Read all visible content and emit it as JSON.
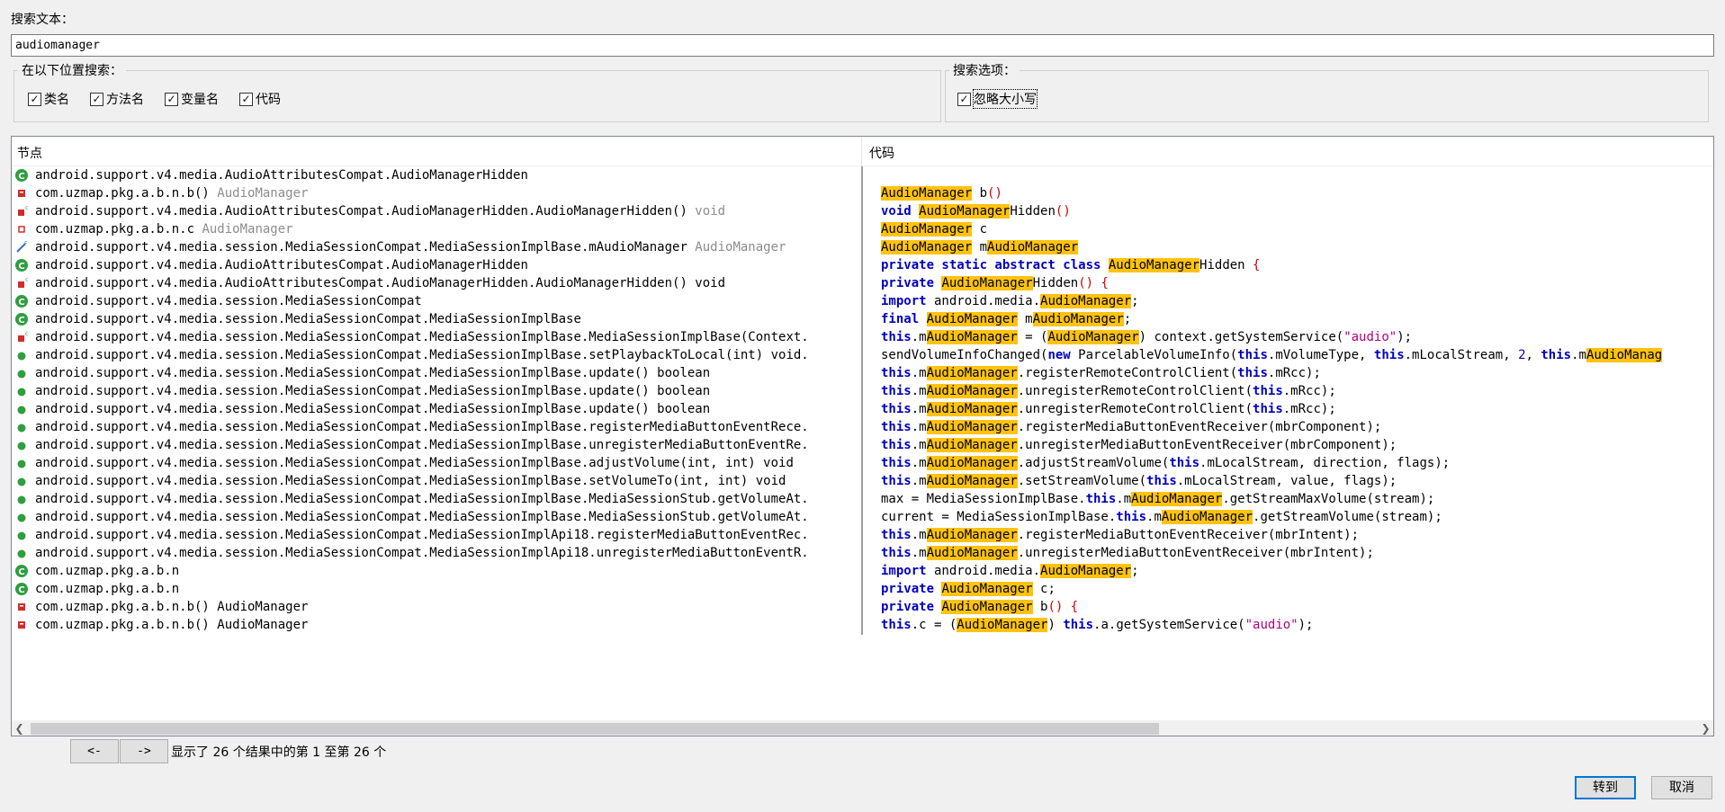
{
  "search": {
    "label": "搜索文本：",
    "value": "audiomanager"
  },
  "location_group": {
    "title": "在以下位置搜索：",
    "options": [
      {
        "label": "类名",
        "checked": true
      },
      {
        "label": "方法名",
        "checked": true
      },
      {
        "label": "变量名",
        "checked": true
      },
      {
        "label": "代码",
        "checked": true
      }
    ]
  },
  "options_group": {
    "title": "搜索选项：",
    "options": [
      {
        "label": "忽略大小写",
        "checked": true
      }
    ]
  },
  "columns": {
    "node": "节点",
    "code": "代码"
  },
  "colors": {
    "highlight": "#ffc30f",
    "keyword": "#0000c0",
    "string": "#b0007e",
    "class_icon": "#2e9e3e",
    "field_icon": "#d22b2b",
    "accent": "#0078d7"
  },
  "nodes": [
    {
      "icon": "class-icon",
      "text": "android.support.v4.media.AudioAttributesCompat.AudioManagerHidden",
      "type": ""
    },
    {
      "icon": "method-icon",
      "text": "com.uzmap.pkg.a.b.n.b()",
      "type": "AudioManager",
      "dim": true
    },
    {
      "icon": "constructor-icon",
      "text": "android.support.v4.media.AudioAttributesCompat.AudioManagerHidden.AudioManagerHidden()",
      "type": "void",
      "dim": true
    },
    {
      "icon": "field-icon",
      "text": "com.uzmap.pkg.a.b.n.c",
      "type": "AudioManager",
      "dim": true
    },
    {
      "icon": "field-final-icon",
      "text": "android.support.v4.media.session.MediaSessionCompat.MediaSessionImplBase.mAudioManager",
      "type": "AudioManager",
      "dim": true
    },
    {
      "icon": "class-icon",
      "text": "android.support.v4.media.AudioAttributesCompat.AudioManagerHidden",
      "type": ""
    },
    {
      "icon": "constructor-icon",
      "text": "android.support.v4.media.AudioAttributesCompat.AudioManagerHidden.AudioManagerHidden() void",
      "type": ""
    },
    {
      "icon": "class-icon",
      "text": "android.support.v4.media.session.MediaSessionCompat",
      "type": ""
    },
    {
      "icon": "class-icon",
      "text": "android.support.v4.media.session.MediaSessionCompat.MediaSessionImplBase",
      "type": ""
    },
    {
      "icon": "constructor-icon",
      "text": "android.support.v4.media.session.MediaSessionCompat.MediaSessionImplBase.MediaSessionImplBase(Context.",
      "type": ""
    },
    {
      "icon": "public-method-icon",
      "text": "android.support.v4.media.session.MediaSessionCompat.MediaSessionImplBase.setPlaybackToLocal(int) void.",
      "type": ""
    },
    {
      "icon": "public-method-icon",
      "text": "android.support.v4.media.session.MediaSessionCompat.MediaSessionImplBase.update() boolean",
      "type": ""
    },
    {
      "icon": "public-method-icon",
      "text": "android.support.v4.media.session.MediaSessionCompat.MediaSessionImplBase.update() boolean",
      "type": ""
    },
    {
      "icon": "public-method-icon",
      "text": "android.support.v4.media.session.MediaSessionCompat.MediaSessionImplBase.update() boolean",
      "type": ""
    },
    {
      "icon": "public-method-icon",
      "text": "android.support.v4.media.session.MediaSessionCompat.MediaSessionImplBase.registerMediaButtonEventRece.",
      "type": ""
    },
    {
      "icon": "public-method-icon",
      "text": "android.support.v4.media.session.MediaSessionCompat.MediaSessionImplBase.unregisterMediaButtonEventRe.",
      "type": ""
    },
    {
      "icon": "public-method-icon",
      "text": "android.support.v4.media.session.MediaSessionCompat.MediaSessionImplBase.adjustVolume(int, int) void",
      "type": ""
    },
    {
      "icon": "public-method-icon",
      "text": "android.support.v4.media.session.MediaSessionCompat.MediaSessionImplBase.setVolumeTo(int, int) void",
      "type": ""
    },
    {
      "icon": "public-method-icon",
      "text": "android.support.v4.media.session.MediaSessionCompat.MediaSessionImplBase.MediaSessionStub.getVolumeAt.",
      "type": ""
    },
    {
      "icon": "public-method-icon",
      "text": "android.support.v4.media.session.MediaSessionCompat.MediaSessionImplBase.MediaSessionStub.getVolumeAt.",
      "type": ""
    },
    {
      "icon": "public-method-icon",
      "text": "android.support.v4.media.session.MediaSessionCompat.MediaSessionImplApi18.registerMediaButtonEventRec.",
      "type": ""
    },
    {
      "icon": "public-method-icon",
      "text": "android.support.v4.media.session.MediaSessionCompat.MediaSessionImplApi18.unregisterMediaButtonEventR.",
      "type": ""
    },
    {
      "icon": "class-icon",
      "text": "com.uzmap.pkg.a.b.n",
      "type": ""
    },
    {
      "icon": "class-icon",
      "text": "com.uzmap.pkg.a.b.n",
      "type": ""
    },
    {
      "icon": "method-icon",
      "text": "com.uzmap.pkg.a.b.n.b() AudioManager",
      "type": ""
    },
    {
      "icon": "method-icon",
      "text": "com.uzmap.pkg.a.b.n.b() AudioManager",
      "type": ""
    }
  ],
  "code_lines": [
    [
      {
        "t": "AudioManager",
        "c": "hl"
      },
      {
        "t": " b"
      },
      {
        "t": "()",
        "c": "paren"
      }
    ],
    [
      {
        "t": "void",
        "c": "kw"
      },
      {
        "t": " "
      },
      {
        "t": "AudioManager",
        "c": "hl"
      },
      {
        "t": "Hidden"
      },
      {
        "t": "()",
        "c": "paren"
      }
    ],
    [
      {
        "t": "AudioManager",
        "c": "hl"
      },
      {
        "t": " c"
      }
    ],
    [
      {
        "t": "AudioManager",
        "c": "hl"
      },
      {
        "t": " m"
      },
      {
        "t": "AudioManager",
        "c": "hl"
      }
    ],
    [
      {
        "t": "private static abstract class",
        "c": "kw"
      },
      {
        "t": " "
      },
      {
        "t": "AudioManager",
        "c": "hl"
      },
      {
        "t": "Hidden "
      },
      {
        "t": "{",
        "c": "paren"
      }
    ],
    [
      {
        "t": "private",
        "c": "kw"
      },
      {
        "t": " "
      },
      {
        "t": "AudioManager",
        "c": "hl"
      },
      {
        "t": "Hidden"
      },
      {
        "t": "() {",
        "c": "paren"
      }
    ],
    [
      {
        "t": "import",
        "c": "kw"
      },
      {
        "t": " android.media."
      },
      {
        "t": "AudioManager",
        "c": "hl"
      },
      {
        "t": ";"
      }
    ],
    [
      {
        "t": "final",
        "c": "kw"
      },
      {
        "t": " "
      },
      {
        "t": "AudioManager",
        "c": "hl"
      },
      {
        "t": " m"
      },
      {
        "t": "AudioManager",
        "c": "hl"
      },
      {
        "t": ";"
      }
    ],
    [
      {
        "t": "this",
        "c": "kw"
      },
      {
        "t": ".m"
      },
      {
        "t": "AudioManager",
        "c": "hl"
      },
      {
        "t": " = ("
      },
      {
        "t": "AudioManager",
        "c": "hl"
      },
      {
        "t": ") context.getSystemService("
      },
      {
        "t": "\"audio\"",
        "c": "str"
      },
      {
        "t": ");"
      }
    ],
    [
      {
        "t": "sendVolumeInfoChanged("
      },
      {
        "t": "new",
        "c": "kw"
      },
      {
        "t": " ParcelableVolumeInfo("
      },
      {
        "t": "this",
        "c": "kw"
      },
      {
        "t": ".mVolumeType, "
      },
      {
        "t": "this",
        "c": "kw"
      },
      {
        "t": ".mLocalStream, "
      },
      {
        "t": "2",
        "c": "num"
      },
      {
        "t": ", "
      },
      {
        "t": "this",
        "c": "kw"
      },
      {
        "t": ".m"
      },
      {
        "t": "AudioManag",
        "c": "hl"
      }
    ],
    [
      {
        "t": "this",
        "c": "kw"
      },
      {
        "t": ".m"
      },
      {
        "t": "AudioManager",
        "c": "hl"
      },
      {
        "t": ".registerRemoteControlClient("
      },
      {
        "t": "this",
        "c": "kw"
      },
      {
        "t": ".mRcc);"
      }
    ],
    [
      {
        "t": "this",
        "c": "kw"
      },
      {
        "t": ".m"
      },
      {
        "t": "AudioManager",
        "c": "hl"
      },
      {
        "t": ".unregisterRemoteControlClient("
      },
      {
        "t": "this",
        "c": "kw"
      },
      {
        "t": ".mRcc);"
      }
    ],
    [
      {
        "t": "this",
        "c": "kw"
      },
      {
        "t": ".m"
      },
      {
        "t": "AudioManager",
        "c": "hl"
      },
      {
        "t": ".unregisterRemoteControlClient("
      },
      {
        "t": "this",
        "c": "kw"
      },
      {
        "t": ".mRcc);"
      }
    ],
    [
      {
        "t": "this",
        "c": "kw"
      },
      {
        "t": ".m"
      },
      {
        "t": "AudioManager",
        "c": "hl"
      },
      {
        "t": ".registerMediaButtonEventReceiver(mbrComponent);"
      }
    ],
    [
      {
        "t": "this",
        "c": "kw"
      },
      {
        "t": ".m"
      },
      {
        "t": "AudioManager",
        "c": "hl"
      },
      {
        "t": ".unregisterMediaButtonEventReceiver(mbrComponent);"
      }
    ],
    [
      {
        "t": "this",
        "c": "kw"
      },
      {
        "t": ".m"
      },
      {
        "t": "AudioManager",
        "c": "hl"
      },
      {
        "t": ".adjustStreamVolume("
      },
      {
        "t": "this",
        "c": "kw"
      },
      {
        "t": ".mLocalStream, direction, flags);"
      }
    ],
    [
      {
        "t": "this",
        "c": "kw"
      },
      {
        "t": ".m"
      },
      {
        "t": "AudioManager",
        "c": "hl"
      },
      {
        "t": ".setStreamVolume("
      },
      {
        "t": "this",
        "c": "kw"
      },
      {
        "t": ".mLocalStream, value, flags);"
      }
    ],
    [
      {
        "t": "max = MediaSessionImplBase."
      },
      {
        "t": "this",
        "c": "kw"
      },
      {
        "t": ".m"
      },
      {
        "t": "AudioManager",
        "c": "hl"
      },
      {
        "t": ".getStreamMaxVolume(stream);"
      }
    ],
    [
      {
        "t": "current = MediaSessionImplBase."
      },
      {
        "t": "this",
        "c": "kw"
      },
      {
        "t": ".m"
      },
      {
        "t": "AudioManager",
        "c": "hl"
      },
      {
        "t": ".getStreamVolume(stream);"
      }
    ],
    [
      {
        "t": "this",
        "c": "kw"
      },
      {
        "t": ".m"
      },
      {
        "t": "AudioManager",
        "c": "hl"
      },
      {
        "t": ".registerMediaButtonEventReceiver(mbrIntent);"
      }
    ],
    [
      {
        "t": "this",
        "c": "kw"
      },
      {
        "t": ".m"
      },
      {
        "t": "AudioManager",
        "c": "hl"
      },
      {
        "t": ".unregisterMediaButtonEventReceiver(mbrIntent);"
      }
    ],
    [
      {
        "t": "import",
        "c": "kw"
      },
      {
        "t": " android.media."
      },
      {
        "t": "AudioManager",
        "c": "hl"
      },
      {
        "t": ";"
      }
    ],
    [
      {
        "t": "private",
        "c": "kw"
      },
      {
        "t": " "
      },
      {
        "t": "AudioManager",
        "c": "hl"
      },
      {
        "t": " c;"
      }
    ],
    [
      {
        "t": "private",
        "c": "kw"
      },
      {
        "t": " "
      },
      {
        "t": "AudioManager",
        "c": "hl"
      },
      {
        "t": " b"
      },
      {
        "t": "() {",
        "c": "paren"
      }
    ],
    [
      {
        "t": "this",
        "c": "kw"
      },
      {
        "t": ".c = ("
      },
      {
        "t": "AudioManager",
        "c": "hl"
      },
      {
        "t": ") "
      },
      {
        "t": "this",
        "c": "kw"
      },
      {
        "t": ".a.getSystemService("
      },
      {
        "t": "\"audio\"",
        "c": "str"
      },
      {
        "t": ");"
      }
    ]
  ],
  "nav": {
    "prev_label": "<-",
    "next_label": "->",
    "status": "显示了 26 个结果中的第 1 至第 26 个"
  },
  "buttons": {
    "goto": "转到",
    "cancel": "取消"
  }
}
